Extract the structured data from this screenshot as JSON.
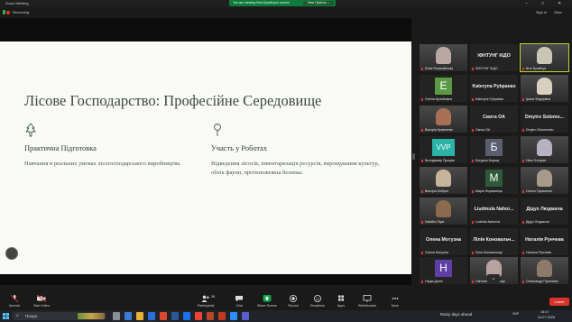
{
  "window": {
    "title": "Zoom Meeting",
    "minimize": "–",
    "maximize": "□",
    "close": "✕"
  },
  "banner": {
    "sharing_text": "You are viewing Віта Бугайчук's screen",
    "view_options": "View Options ⌄"
  },
  "topbar": {
    "recording": "Recording",
    "sign_in": "Sign in",
    "view": "View"
  },
  "slide": {
    "title": "Лісове Господарство: Професійне Середовище",
    "left": {
      "icon": "tree-icon",
      "heading": "Практична Підготовка",
      "body": "Навчання в реальних умовах лісогосподарського виробництва."
    },
    "right": {
      "icon": "pin-icon",
      "heading": "Участь у Роботах",
      "body": "Відведення лісосік, інвентаризація ресурсів, вирощування культур, облік фауни, протипожежна безпека."
    }
  },
  "gallery": {
    "tiles": [
      {
        "name": "Юлія Ремигайлова",
        "kind": "photo",
        "tone": "#b9a7a4"
      },
      {
        "name": "ІФНТУНГ КІДО",
        "kind": "text",
        "big": "ІФНТУНГ КІДО"
      },
      {
        "name": "Віта Бугайчук",
        "kind": "photo",
        "tone": "#c9c6b6",
        "speaking": true
      },
      {
        "name": "Олена Булейсівна",
        "kind": "letter",
        "letter": "E",
        "tone": "#5a9a44"
      },
      {
        "name": "Katerуna Pуbранко",
        "kind": "text",
        "big": "Katerуna Руbранко"
      },
      {
        "name": "Ірина Федорівна",
        "kind": "photo",
        "tone": "#d9cfc0"
      },
      {
        "name": "Вікторія Кравченко",
        "kind": "photo",
        "tone": "#a76f55"
      },
      {
        "name": "Свита ОА",
        "kind": "text",
        "big": "Свита ОА"
      },
      {
        "name": "Dmytro Solomonko",
        "kind": "text",
        "big": "Dmytro Solomo..."
      },
      {
        "name": "Володимир Процюк",
        "kind": "letter",
        "letter": "VVP",
        "tone": "#2ab3a6"
      },
      {
        "name": "Богдана Борищ",
        "kind": "letter",
        "letter": "Б",
        "tone": "#5a5f6e"
      },
      {
        "name": "Ніна Отецька",
        "kind": "photo",
        "tone": "#b7b1c2"
      },
      {
        "name": "Вікторія Кобрин",
        "kind": "photo",
        "tone": "#c6b49c"
      },
      {
        "name": "Марія Форманець",
        "kind": "letter",
        "letter": "М",
        "tone": "#2e5a3a"
      },
      {
        "name": "Олеся Тарасенко",
        "kind": "photo",
        "tone": "#a89b8a"
      },
      {
        "name": "Nataliia Olyar",
        "kind": "photo",
        "tone": "#8b6a4e"
      },
      {
        "name": "Ludmila Nahorna",
        "kind": "text",
        "big": "Liudmula Nahor..."
      },
      {
        "name": "Дідух Людмила",
        "kind": "text",
        "big": "Дідух Людмила"
      },
      {
        "name": "Олена Мотузна",
        "kind": "text",
        "big": "Олена Мотузна"
      },
      {
        "name": "Лілія Коновальчук",
        "kind": "text",
        "big": "Лілія Коновальч..."
      },
      {
        "name": "Наталія Рунчева",
        "kind": "text",
        "big": "Наталія Рунчева"
      },
      {
        "name": "Надія Дилін",
        "kind": "letter",
        "letter": "Н",
        "tone": "#5e3fa5"
      },
      {
        "name": "Світлана Ковальчук",
        "kind": "photo",
        "tone": "#b6a3a0"
      },
      {
        "name": "Олександр Протинюк",
        "kind": "photo",
        "tone": "#8c7a6a"
      }
    ]
  },
  "toolbar": {
    "unmute": "Unmute",
    "start_video": "Start Video",
    "participants": "Participants",
    "participants_count": "36",
    "chat": "Chat",
    "share_screen": "Share Screen",
    "record": "Record",
    "reactions": "Reactions",
    "apps": "Apps",
    "whiteboards": "Whiteboards",
    "more": "More",
    "leave": "Leave"
  },
  "taskbar": {
    "search_placeholder": "Пошук",
    "weather": "Rainy days ahead",
    "lang": "УКР",
    "time": "15:47",
    "date": "24.07.2025"
  },
  "colors": {
    "accent_green": "#0e7a3c",
    "leave_red": "#d9342b",
    "speaking_border": "#b8d832",
    "slide_bg": "#fafaf7"
  }
}
